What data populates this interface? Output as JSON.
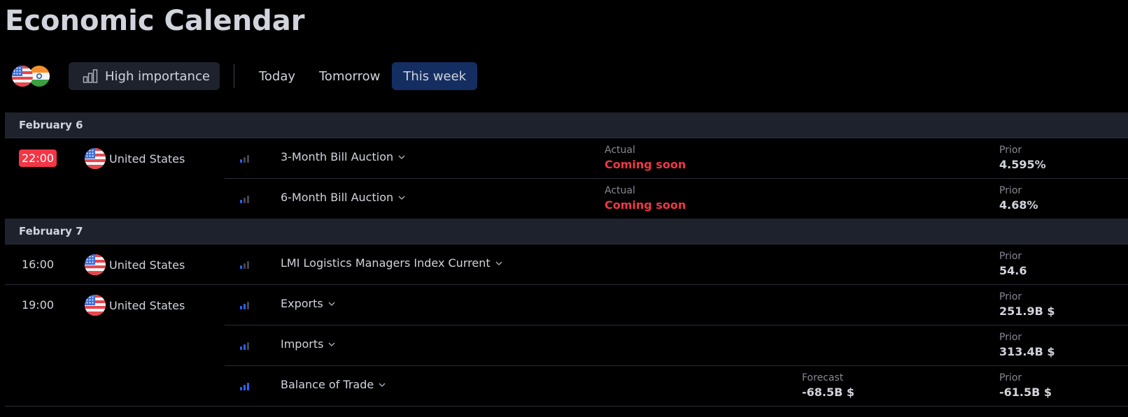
{
  "page": {
    "title": "Economic Calendar"
  },
  "toolbar": {
    "countries_filter": [
      "United States",
      "India"
    ],
    "importance_label": "High importance",
    "ranges": [
      {
        "label": "Today",
        "active": false
      },
      {
        "label": "Tomorrow",
        "active": false
      },
      {
        "label": "This week",
        "active": true
      }
    ]
  },
  "colors": {
    "accent_active": "#142e61",
    "live_badge": "#f23645",
    "importance_on": "#2962ff",
    "importance_off": "#434651",
    "coming_soon": "#f23645"
  },
  "days": [
    {
      "date": "February 6",
      "groups": [
        {
          "time": "22:00",
          "live": true,
          "country": "United States",
          "flag": "us-flag-icon",
          "events": [
            {
              "name": "3-Month Bill Auction",
              "importance": 1,
              "actual_label": "Actual",
              "actual": "Coming soon",
              "prior_label": "Prior",
              "prior": "4.595%"
            },
            {
              "name": "6-Month Bill Auction",
              "importance": 1,
              "actual_label": "Actual",
              "actual": "Coming soon",
              "prior_label": "Prior",
              "prior": "4.68%"
            }
          ]
        }
      ]
    },
    {
      "date": "February 7",
      "groups": [
        {
          "time": "16:00",
          "live": false,
          "country": "United States",
          "flag": "us-flag-icon",
          "events": [
            {
              "name": "LMI Logistics Managers Index Current",
              "importance": 1,
              "prior_label": "Prior",
              "prior": "54.6"
            }
          ]
        },
        {
          "time": "19:00",
          "live": false,
          "country": "United States",
          "flag": "us-flag-icon",
          "events": [
            {
              "name": "Exports",
              "importance": 2,
              "prior_label": "Prior",
              "prior": "251.9B $"
            },
            {
              "name": "Imports",
              "importance": 2,
              "prior_label": "Prior",
              "prior": "313.4B $"
            },
            {
              "name": "Balance of Trade",
              "importance": 3,
              "forecast_label": "Forecast",
              "forecast": "-68.5B $",
              "prior_label": "Prior",
              "prior": "-61.5B $"
            }
          ]
        }
      ]
    }
  ]
}
